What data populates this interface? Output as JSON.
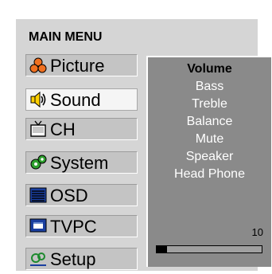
{
  "menu": {
    "title": "MAIN MENU",
    "items": [
      {
        "label": "Picture",
        "icon": "picture-icon",
        "active": false
      },
      {
        "label": "Sound",
        "icon": "speaker-icon",
        "active": true
      },
      {
        "label": "CH",
        "icon": "tv-icon",
        "active": false
      },
      {
        "label": "System",
        "icon": "gears-icon",
        "active": false
      },
      {
        "label": "OSD",
        "icon": "osd-icon",
        "active": false
      },
      {
        "label": "TVPC",
        "icon": "monitor-icon",
        "active": false
      },
      {
        "label": "Setup",
        "icon": "setup-icon",
        "active": false
      }
    ]
  },
  "submenu": {
    "items": [
      "Volume",
      "Bass",
      "Treble",
      "Balance",
      "Mute",
      "Speaker",
      "Head Phone"
    ],
    "selected": "Volume",
    "value_text": "10",
    "level": 0.1
  },
  "colors": {
    "panel": "#d5d5d5",
    "submenu_bg": "#8a8a8a",
    "active_item": "#f5f5f5"
  }
}
